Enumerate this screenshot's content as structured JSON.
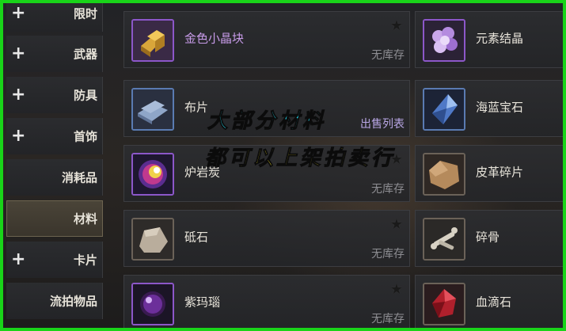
{
  "sidebar": {
    "tabs": [
      {
        "label": "限时",
        "has_expand": true
      },
      {
        "label": "武器",
        "has_expand": true
      },
      {
        "label": "防具",
        "has_expand": true
      },
      {
        "label": "首饰",
        "has_expand": true
      },
      {
        "label": "消耗品",
        "has_expand": false
      },
      {
        "label": "材料",
        "has_expand": false,
        "active": true
      },
      {
        "label": "卡片",
        "has_expand": true
      },
      {
        "label": "流拍物品",
        "has_expand": false
      }
    ],
    "expand_glyph": "+"
  },
  "items": [
    {
      "name": "金色小晶块",
      "status": "无库存",
      "star": "★",
      "icon": "gold-crystal-icon"
    },
    {
      "name": "元素结晶",
      "status": "",
      "star": "",
      "icon": "element-crystal-icon"
    },
    {
      "name": "布片",
      "status": "出售列表",
      "star": "",
      "icon": "cloth-icon"
    },
    {
      "name": "海蓝宝石",
      "status": "",
      "star": "",
      "icon": "aquamarine-icon"
    },
    {
      "name": "炉岩炭",
      "status": "无库存",
      "star": "★",
      "icon": "lava-coal-icon"
    },
    {
      "name": "皮革碎片",
      "status": "",
      "star": "",
      "icon": "leather-icon"
    },
    {
      "name": "砥石",
      "status": "无库存",
      "star": "★",
      "icon": "whetstone-icon"
    },
    {
      "name": "碎骨",
      "status": "",
      "star": "",
      "icon": "bone-icon"
    },
    {
      "name": "紫玛瑙",
      "status": "无库存",
      "star": "★",
      "icon": "purple-agate-icon"
    },
    {
      "name": "血滴石",
      "status": "",
      "star": "",
      "icon": "blood-stone-icon"
    }
  ],
  "overlay": {
    "line1": "大部分材料",
    "line2": "都可以上架拍卖行"
  },
  "colors": {
    "border_green": "#19d419",
    "caption1": "#25e8ff",
    "caption2": "#ffef2a"
  }
}
